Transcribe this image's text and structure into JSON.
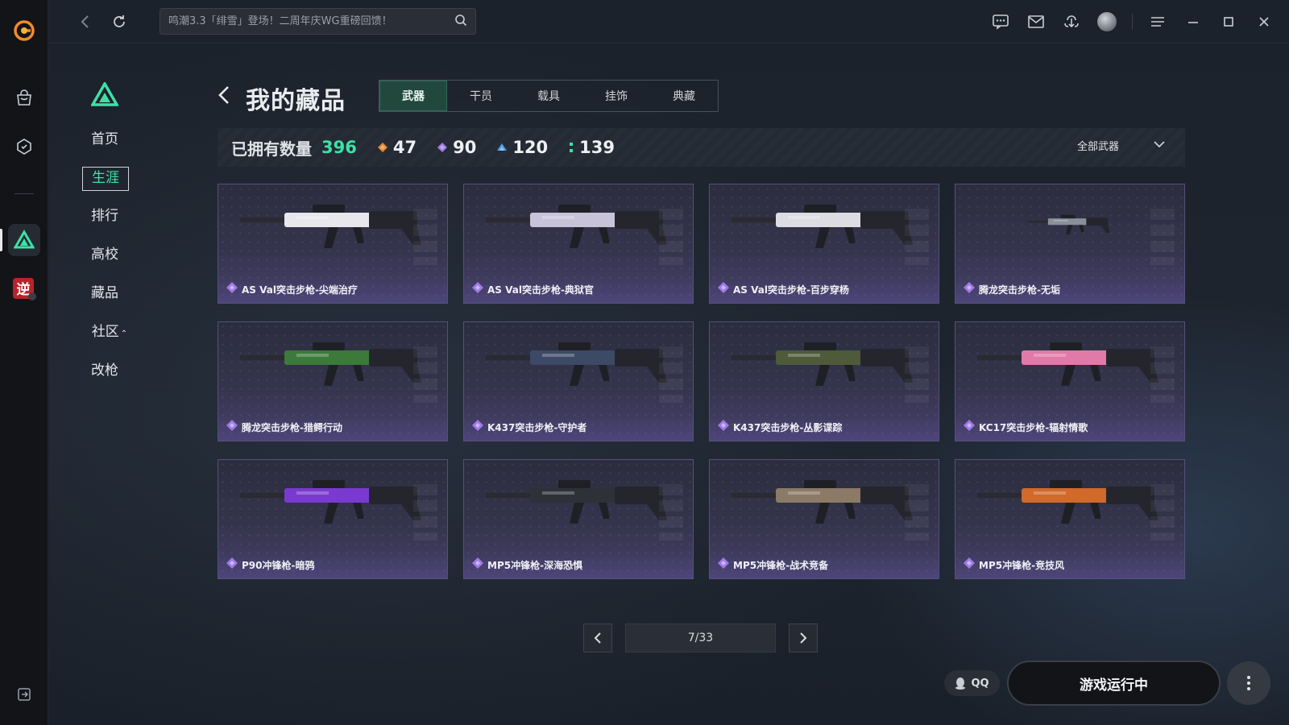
{
  "search": {
    "placeholder": "鸣潮3.3「绯雪」登场！二周年庆WG重磅回馈！"
  },
  "subnav": {
    "items": [
      {
        "label": "首页"
      },
      {
        "label": "生涯"
      },
      {
        "label": "排行"
      },
      {
        "label": "高校"
      },
      {
        "label": "藏品"
      },
      {
        "label": "社区"
      },
      {
        "label": "改枪"
      }
    ],
    "community_caret": "⌃"
  },
  "header": {
    "title": "我的藏品",
    "tabs": [
      {
        "label": "武器"
      },
      {
        "label": "干员"
      },
      {
        "label": "载具"
      },
      {
        "label": "挂饰"
      },
      {
        "label": "典藏"
      }
    ]
  },
  "stats": {
    "label": "已拥有数量",
    "total": "396",
    "rarities": [
      {
        "count": "47",
        "color": "#e08a3a"
      },
      {
        "count": "90",
        "color": "#9f7ae6"
      },
      {
        "count": "120",
        "color": "#4f9de8"
      },
      {
        "count": "139",
        "color": "#3de1a8"
      }
    ],
    "filter_label": "全部武器"
  },
  "cards": [
    {
      "name": "AS Val突击步枪-尖端治疗",
      "accent": "#e8e8ec"
    },
    {
      "name": "AS Val突击步枪-典狱官",
      "accent": "#c9c3d9"
    },
    {
      "name": "AS Val突击步枪-百步穿杨",
      "accent": "#dcdce2"
    },
    {
      "name": "腾龙突击步枪-无垢",
      "accent": "#8a8f99"
    },
    {
      "name": "腾龙突击步枪-猎鳄行动",
      "accent": "#3b7a3a"
    },
    {
      "name": "K437突击步枪-守护者",
      "accent": "#3c4a66"
    },
    {
      "name": "K437突击步枪-丛影谍踪",
      "accent": "#4e5a3a"
    },
    {
      "name": "KC17突击步枪-辐射情歌",
      "accent": "#e07aa8"
    },
    {
      "name": "P90冲锋枪-暗鸦",
      "accent": "#7a3ad0"
    },
    {
      "name": "MP5冲锋枪-深海恐惧",
      "accent": "#2e3138"
    },
    {
      "name": "MP5冲锋枪-战术竞备",
      "accent": "#8a7a66"
    },
    {
      "name": "MP5冲锋枪-竞技风",
      "accent": "#d0692a"
    }
  ],
  "pagination": {
    "text": "7/33"
  },
  "footer": {
    "qq_label": "QQ",
    "launch_label": "游戏运行中"
  },
  "colors": {
    "accent": "#3de1a8",
    "rarity_gem": "#9f7ae6"
  }
}
